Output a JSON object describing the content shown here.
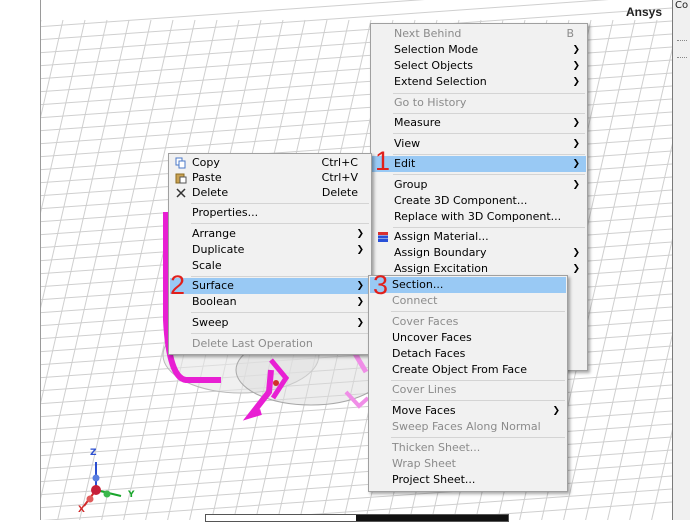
{
  "app": {
    "brand": "Ansys",
    "right_tab": "Co"
  },
  "triad": {
    "z": "Z",
    "y": "Y",
    "x": "X"
  },
  "colors": {
    "highlight": "#99c9f4",
    "step_number": "#e0201c",
    "model": "#e81fd3"
  },
  "steps": [
    "1",
    "2",
    "3"
  ],
  "edit_menu": [
    {
      "label": "Next Behind",
      "shortcut": "B",
      "disabled": true
    },
    {
      "label": "Selection Mode",
      "submenu": true
    },
    {
      "label": "Select Objects",
      "submenu": true
    },
    {
      "label": "Extend Selection",
      "submenu": true
    },
    {
      "label": "Go to History",
      "disabled": true
    },
    {
      "label": "Measure",
      "submenu": true
    },
    {
      "label": "View",
      "submenu": true
    },
    {
      "label": "Edit",
      "submenu": true,
      "highlighted": true
    },
    {
      "label": "Group",
      "submenu": true
    },
    {
      "label": "Create 3D Component..."
    },
    {
      "label": "Replace with 3D Component..."
    },
    {
      "label": "Assign Material...",
      "icon": "material-icon"
    },
    {
      "label": "Assign Boundary",
      "submenu": true
    },
    {
      "label": "Assign Excitation",
      "submenu": true
    }
  ],
  "main_menu": [
    {
      "label": "Copy",
      "shortcut": "Ctrl+C",
      "icon": "copy-icon"
    },
    {
      "label": "Paste",
      "shortcut": "Ctrl+V",
      "icon": "paste-icon"
    },
    {
      "label": "Delete",
      "shortcut": "Delete",
      "icon": "delete-icon"
    },
    {
      "label": "Properties..."
    },
    {
      "label": "Arrange",
      "submenu": true
    },
    {
      "label": "Duplicate",
      "submenu": true
    },
    {
      "label": "Scale"
    },
    {
      "label": "Surface",
      "submenu": true,
      "highlighted": true
    },
    {
      "label": "Boolean",
      "submenu": true
    },
    {
      "label": "Sweep",
      "submenu": true
    },
    {
      "label": "Delete Last Operation",
      "disabled": true
    }
  ],
  "surface_menu": [
    {
      "label": "Section...",
      "highlighted": true
    },
    {
      "label": "Connect",
      "disabled": true
    },
    {
      "label": "Cover Faces",
      "disabled": true
    },
    {
      "label": "Uncover Faces"
    },
    {
      "label": "Detach Faces"
    },
    {
      "label": "Create Object From Face"
    },
    {
      "label": "Cover Lines",
      "disabled": true
    },
    {
      "label": "Move Faces",
      "submenu": true
    },
    {
      "label": "Sweep Faces Along Normal",
      "disabled": true
    },
    {
      "label": "Thicken Sheet...",
      "disabled": true
    },
    {
      "label": "Wrap Sheet",
      "disabled": true
    },
    {
      "label": "Project Sheet..."
    }
  ]
}
